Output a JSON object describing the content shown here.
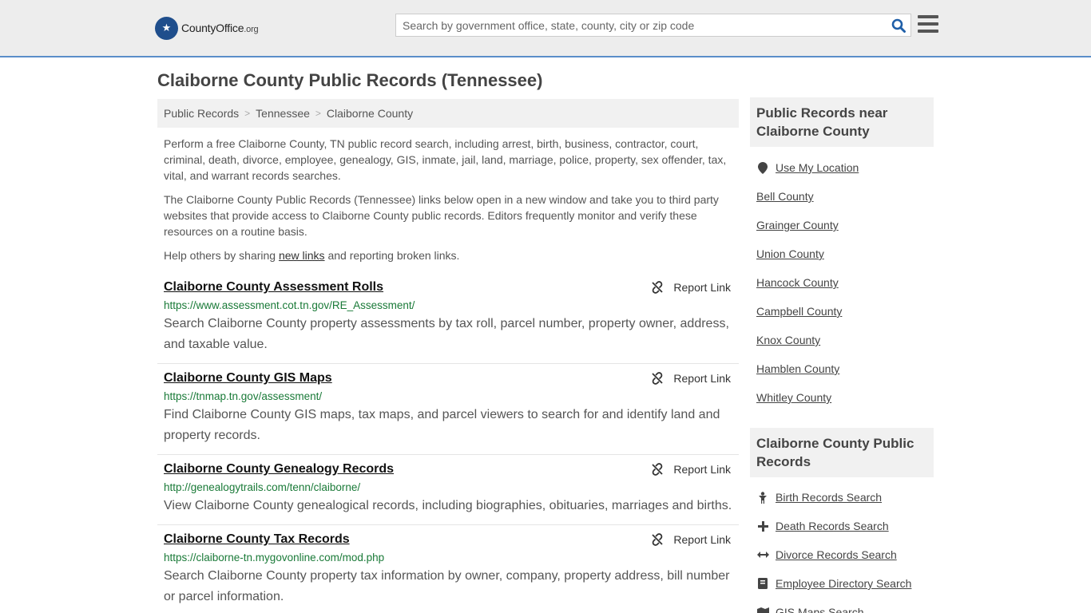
{
  "header": {
    "logo_brand": "County",
    "logo_brand_bold": "Office",
    "logo_tld": ".org",
    "search_placeholder": "Search by government office, state, county, city or zip code"
  },
  "page_title": "Claiborne County Public Records (Tennessee)",
  "breadcrumb": [
    "Public Records",
    "Tennessee",
    "Claiborne County"
  ],
  "intro": {
    "p1": "Perform a free Claiborne County, TN public record search, including arrest, birth, business, contractor, court, criminal, death, divorce, employee, genealogy, GIS, inmate, jail, land, marriage, police, property, sex offender, tax, vital, and warrant records searches.",
    "p2": "The Claiborne County Public Records (Tennessee) links below open in a new window and take you to third party websites that provide access to Claiborne County public records. Editors frequently monitor and verify these resources on a routine basis.",
    "p3_before": "Help others by sharing ",
    "p3_link": "new links",
    "p3_after": " and reporting broken links."
  },
  "report_label": "Report Link",
  "records": [
    {
      "title": "Claiborne County Assessment Rolls",
      "url": "https://www.assessment.cot.tn.gov/RE_Assessment/",
      "desc": "Search Claiborne County property assessments by tax roll, parcel number, property owner, address, and taxable value."
    },
    {
      "title": "Claiborne County GIS Maps",
      "url": "https://tnmap.tn.gov/assessment/",
      "desc": "Find Claiborne County GIS maps, tax maps, and parcel viewers to search for and identify land and property records."
    },
    {
      "title": "Claiborne County Genealogy Records",
      "url": "http://genealogytrails.com/tenn/claiborne/",
      "desc": "View Claiborne County genealogical records, including biographies, obituaries, marriages and births."
    },
    {
      "title": "Claiborne County Tax Records",
      "url": "https://claiborne-tn.mygovonline.com/mod.php",
      "desc": "Search Claiborne County property tax information by owner, company, property address, bill number or parcel information."
    }
  ],
  "sidebar": {
    "near_title": "Public Records near Claiborne County",
    "near_items": [
      {
        "label": "Use My Location",
        "icon": "map-pin-icon"
      },
      {
        "label": "Bell County"
      },
      {
        "label": "Grainger County"
      },
      {
        "label": "Union County"
      },
      {
        "label": "Hancock County"
      },
      {
        "label": "Campbell County"
      },
      {
        "label": "Knox County"
      },
      {
        "label": "Hamblen County"
      },
      {
        "label": "Whitley County"
      }
    ],
    "records_title": "Claiborne County Public Records",
    "records_items": [
      {
        "label": "Birth Records Search",
        "icon": "baby-icon"
      },
      {
        "label": "Death Records Search",
        "icon": "cross-icon"
      },
      {
        "label": "Divorce Records Search",
        "icon": "arrows-horizontal-icon"
      },
      {
        "label": "Employee Directory Search",
        "icon": "book-icon"
      },
      {
        "label": "GIS Maps Search",
        "icon": "map-icon"
      }
    ]
  }
}
